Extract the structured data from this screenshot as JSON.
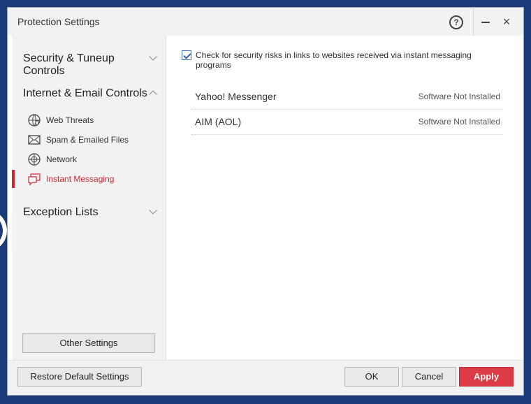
{
  "window": {
    "title": "Protection Settings"
  },
  "sidebar": {
    "groups": [
      {
        "label": "Security & Tuneup Controls",
        "expanded": false
      },
      {
        "label": "Internet & Email Controls",
        "expanded": true
      },
      {
        "label": "Exception Lists",
        "expanded": false
      }
    ],
    "items": [
      {
        "label": "Web Threats",
        "icon": "globe-shield-icon"
      },
      {
        "label": "Spam & Emailed Files",
        "icon": "envelope-icon"
      },
      {
        "label": "Network",
        "icon": "network-globe-icon"
      },
      {
        "label": "Instant Messaging",
        "icon": "chat-bubble-icon",
        "active": true
      }
    ],
    "other_settings_label": "Other Settings"
  },
  "content": {
    "checkbox": {
      "label": "Check for security risks in links to websites received via instant messaging programs",
      "checked": true
    },
    "rows": [
      {
        "name": "Yahoo! Messenger",
        "status": "Software Not Installed"
      },
      {
        "name": "AIM (AOL)",
        "status": "Software Not Installed"
      }
    ]
  },
  "footer": {
    "restore_label": "Restore Default Settings",
    "ok_label": "OK",
    "cancel_label": "Cancel",
    "apply_label": "Apply"
  },
  "colors": {
    "accent": "#d0262e",
    "apply": "#dc3b45",
    "checkbox": "#2a64c0",
    "background": "#1b3a7a"
  }
}
